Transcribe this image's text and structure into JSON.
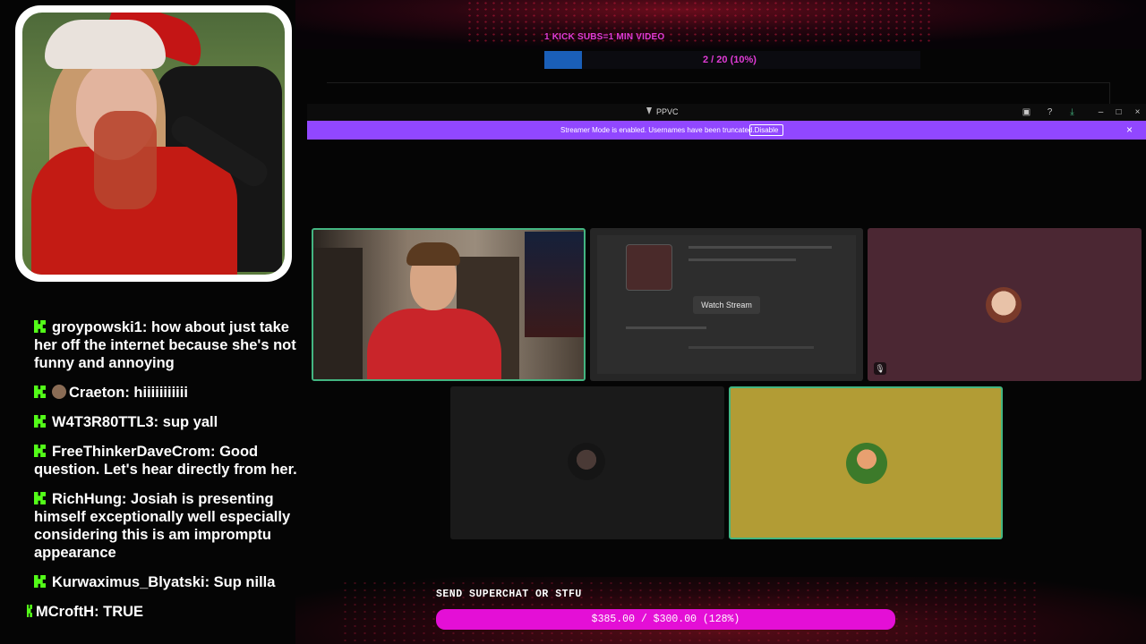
{
  "overlay": {
    "goal_title": "1 KICK SUBS=1 MIN VIDEO",
    "goal_count": "2 / 20 (10%)",
    "goal_progress": 0.1,
    "superchat_label": "SEND SUPERCHAT OR STFU",
    "superchat_amount": "$385.00 / $300.00 (128%)",
    "superchat_progress": 1.28,
    "accent_color": "#e40fd6"
  },
  "chat": {
    "messages": [
      {
        "user": "groypowski1:",
        "text": " how about just take her off the internet because she's not funny and annoying"
      },
      {
        "user": "Craeton:",
        "text": " hiiiiiiiiiii"
      },
      {
        "user": "W4T3R80TTL3:",
        "text": " sup yall"
      },
      {
        "user": "FreeThinkerDaveCrom:",
        "text": " Good question. Let's hear directly from her."
      },
      {
        "user": "RichHung:",
        "text": " Josiah is presenting himself exceptionally well especially considering this is am impromptu appearance"
      },
      {
        "user": "Kurwaximus_Blyatski:",
        "text": " Sup nilla"
      },
      {
        "user": "MCroftH:",
        "text": " TRUE"
      }
    ]
  },
  "app": {
    "title": "PPVC",
    "banner_text": "Streamer Mode is enabled. Usernames have been truncated.",
    "banner_button": "Disable",
    "banner_color": "#9147ff",
    "watch_stream": "Watch Stream"
  }
}
